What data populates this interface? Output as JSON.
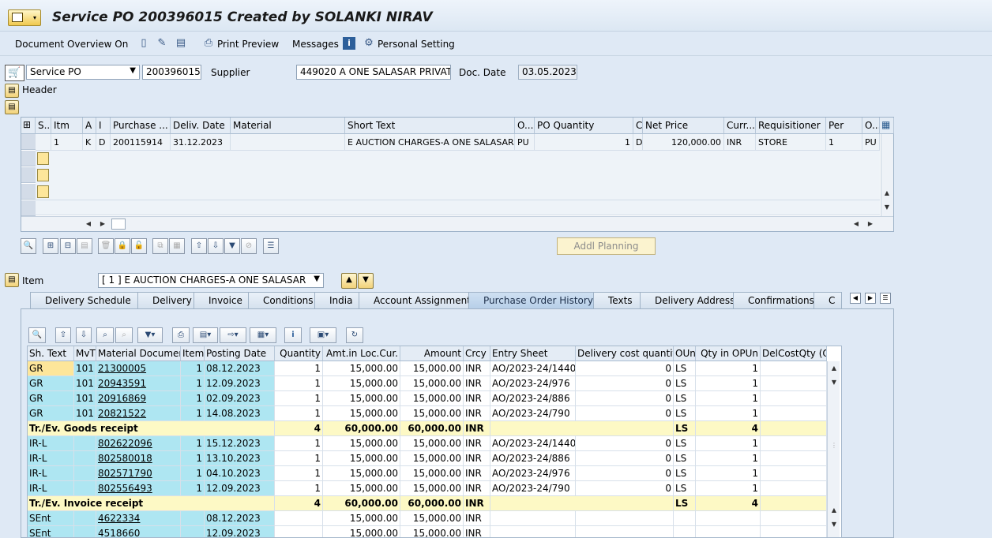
{
  "window": {
    "title": "Service PO 200396015 Created by SOLANKI NIRAV"
  },
  "toolbar": {
    "document_overview": "Document Overview On",
    "print_preview": "Print Preview",
    "messages": "Messages",
    "personal_setting": "Personal Setting"
  },
  "header_fields": {
    "doc_type": "Service PO",
    "po_number": "200396015",
    "supplier_label": "Supplier",
    "supplier_value": "449020 A ONE SALASAR PRIVAT...",
    "doc_date_label": "Doc. Date",
    "doc_date_value": "03.05.2023",
    "header_label": "Header"
  },
  "item_overview": {
    "columns": [
      "S..",
      "Itm",
      "A",
      "I",
      "Purchase ...",
      "Deliv. Date",
      "Material",
      "Short Text",
      "O...",
      "PO Quantity",
      "C",
      "Net Price",
      "Curr...",
      "Requisitioner",
      "Per",
      "O..."
    ],
    "row": {
      "itm": "1",
      "a": "K",
      "i": "D",
      "purchase_req": "200115914",
      "deliv_date": "31.12.2023",
      "material": "",
      "short_text": "E AUCTION CHARGES-A ONE SALASAR",
      "o": "PU",
      "po_quantity": "1",
      "c": "D",
      "net_price": "120,000.00",
      "curr": "INR",
      "requisitioner": "STORE",
      "per": "1",
      "o2": "PU"
    },
    "addl_planning": "Addl Planning"
  },
  "item_detail": {
    "item_label": "Item",
    "item_select": "[ 1 ] E AUCTION CHARGES-A ONE SALASAR",
    "tabs": [
      "Delivery Schedule",
      "Delivery",
      "Invoice",
      "Conditions",
      "India",
      "Account Assignment",
      "Purchase Order History",
      "Texts",
      "Delivery Address",
      "Confirmations",
      "C"
    ],
    "active_tab": "Purchase Order History"
  },
  "history": {
    "columns": [
      "Sh. Text",
      "MvT",
      "Material Document",
      "Item",
      "Posting Date",
      "Quantity",
      "Amt.in Loc.Cur.",
      "Amount",
      "Crcy",
      "Entry Sheet",
      "Delivery cost quantity",
      "OUn",
      "Qty in OPUn",
      "DelCostQty (O"
    ],
    "rows": [
      {
        "type": "row",
        "sh": "GR",
        "mvt": "101",
        "doc": "21300005",
        "item": "1",
        "date": "08.12.2023",
        "qty": "1",
        "amt_loc": "15,000.00",
        "amount": "15,000.00",
        "crcy": "INR",
        "entry": "AO/2023-24/1440",
        "dcq": "0",
        "oun": "LS",
        "qopun": "1"
      },
      {
        "type": "row",
        "sh": "GR",
        "mvt": "101",
        "doc": "20943591",
        "item": "1",
        "date": "12.09.2023",
        "qty": "1",
        "amt_loc": "15,000.00",
        "amount": "15,000.00",
        "crcy": "INR",
        "entry": "AO/2023-24/976",
        "dcq": "0",
        "oun": "LS",
        "qopun": "1"
      },
      {
        "type": "row",
        "sh": "GR",
        "mvt": "101",
        "doc": "20916869",
        "item": "1",
        "date": "02.09.2023",
        "qty": "1",
        "amt_loc": "15,000.00",
        "amount": "15,000.00",
        "crcy": "INR",
        "entry": "AO/2023-24/886",
        "dcq": "0",
        "oun": "LS",
        "qopun": "1"
      },
      {
        "type": "row",
        "sh": "GR",
        "mvt": "101",
        "doc": "20821522",
        "item": "1",
        "date": "14.08.2023",
        "qty": "1",
        "amt_loc": "15,000.00",
        "amount": "15,000.00",
        "crcy": "INR",
        "entry": "AO/2023-24/790",
        "dcq": "0",
        "oun": "LS",
        "qopun": "1"
      },
      {
        "type": "sub",
        "sh": "Tr./Ev. Goods receipt",
        "qty": "4",
        "amt_loc": "60,000.00",
        "amount": "60,000.00",
        "crcy": "INR",
        "oun": "LS",
        "qopun": "4"
      },
      {
        "type": "row",
        "sh": "IR-L",
        "mvt": "",
        "doc": "802622096",
        "item": "1",
        "date": "15.12.2023",
        "qty": "1",
        "amt_loc": "15,000.00",
        "amount": "15,000.00",
        "crcy": "INR",
        "entry": "AO/2023-24/1440",
        "dcq": "0",
        "oun": "LS",
        "qopun": "1"
      },
      {
        "type": "row",
        "sh": "IR-L",
        "mvt": "",
        "doc": "802580018",
        "item": "1",
        "date": "13.10.2023",
        "qty": "1",
        "amt_loc": "15,000.00",
        "amount": "15,000.00",
        "crcy": "INR",
        "entry": "AO/2023-24/886",
        "dcq": "0",
        "oun": "LS",
        "qopun": "1"
      },
      {
        "type": "row",
        "sh": "IR-L",
        "mvt": "",
        "doc": "802571790",
        "item": "1",
        "date": "04.10.2023",
        "qty": "1",
        "amt_loc": "15,000.00",
        "amount": "15,000.00",
        "crcy": "INR",
        "entry": "AO/2023-24/976",
        "dcq": "0",
        "oun": "LS",
        "qopun": "1"
      },
      {
        "type": "row",
        "sh": "IR-L",
        "mvt": "",
        "doc": "802556493",
        "item": "1",
        "date": "12.09.2023",
        "qty": "1",
        "amt_loc": "15,000.00",
        "amount": "15,000.00",
        "crcy": "INR",
        "entry": "AO/2023-24/790",
        "dcq": "0",
        "oun": "LS",
        "qopun": "1"
      },
      {
        "type": "sub",
        "sh": "Tr./Ev. Invoice receipt",
        "qty": "4",
        "amt_loc": "60,000.00",
        "amount": "60,000.00",
        "crcy": "INR",
        "oun": "LS",
        "qopun": "4"
      },
      {
        "type": "row",
        "sh": "SEnt",
        "mvt": "",
        "doc": "4622334",
        "item": "",
        "date": "08.12.2023",
        "qty": "",
        "amt_loc": "15,000.00",
        "amount": "15,000.00",
        "crcy": "INR",
        "entry": "",
        "dcq": "",
        "oun": "",
        "qopun": ""
      },
      {
        "type": "row",
        "sh": "SEnt",
        "mvt": "",
        "doc": "4518660",
        "item": "",
        "date": "12.09.2023",
        "qty": "",
        "amt_loc": "15,000.00",
        "amount": "15,000.00",
        "crcy": "INR",
        "entry": "",
        "dcq": "",
        "oun": "",
        "qopun": ""
      }
    ]
  }
}
